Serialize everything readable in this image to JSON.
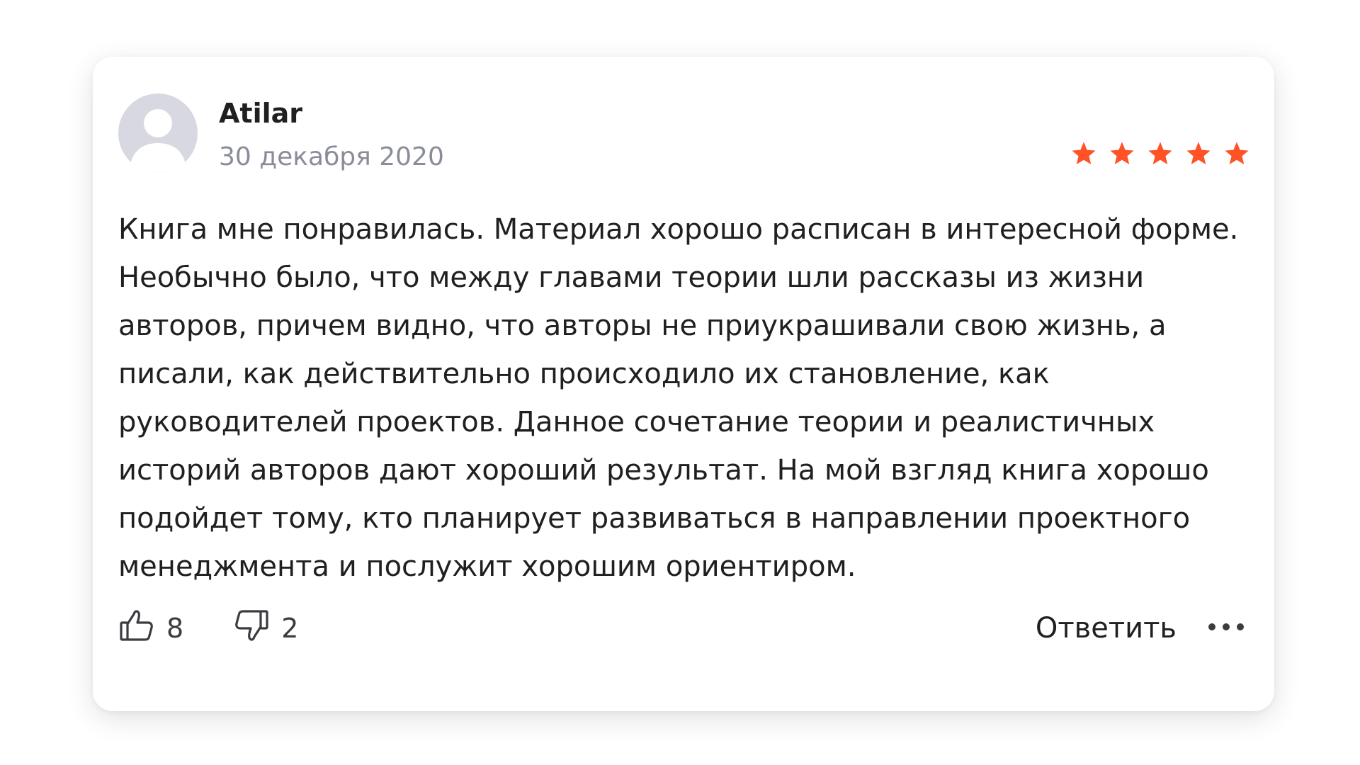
{
  "review": {
    "author": "Atilar",
    "date": "30 декабря 2020",
    "rating": 5,
    "rating_max": 5,
    "star_color": "#ff5226",
    "text": "Книга мне понравилась. Материал хорошо расписан в интересной форме. Необычно было, что между главами теории шли рассказы из жизни авторов, причем видно, что авторы не приукрашивали свою жизнь, а писали, как действительно происходило их становление, как руководителей проектов. Данное сочетание теории и реалистичных историй авторов дают хороший результат. На мой взгляд книга хорошо подойдет тому, кто планирует развиваться в направлении проектного менеджмента и послужит хорошим ориентиром."
  },
  "actions": {
    "like_icon": "thumbs-up-icon",
    "like_count": "8",
    "dislike_icon": "thumbs-down-icon",
    "dislike_count": "2",
    "reply_label": "Ответить",
    "more_icon": "more-dots-icon"
  }
}
